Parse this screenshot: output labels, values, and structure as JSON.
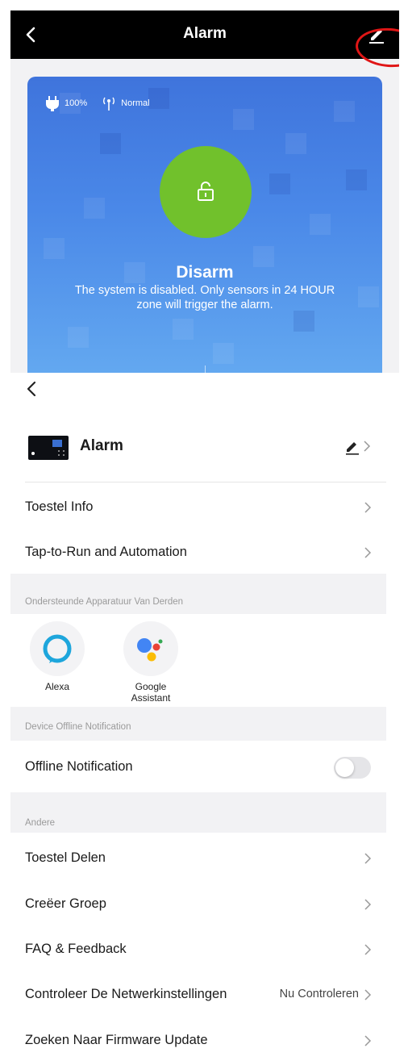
{
  "alarm_screen": {
    "title": "Alarm",
    "battery": "100%",
    "signal": "Normal",
    "mode": "Disarm",
    "mode_description": "The system is disabled. Only sensors in 24 HOUR zone will trigger the alarm.",
    "colors": {
      "header": "#000000",
      "card": "#4a88e8",
      "lock_button": "#71c12c",
      "annotation": "#e01616"
    }
  },
  "settings_screen": {
    "device_name": "Alarm",
    "rows": {
      "device_info": "Toestel Info",
      "tap_to_run": "Tap-to-Run and Automation"
    },
    "third_party_section": "Ondersteunde Apparatuur Van Derden",
    "assistants": [
      {
        "name": "Alexa",
        "icon": "alexa-icon"
      },
      {
        "name": "Google\nAssistant",
        "icon": "google-assistant-icon"
      }
    ],
    "offline_section": "Device Offline Notification",
    "offline_label": "Offline Notification",
    "offline_enabled": false,
    "other_section": "Andere",
    "other_rows": {
      "share": "Toestel Delen",
      "group": "Creëer Groep",
      "faq": "FAQ & Feedback",
      "network": "Controleer De Netwerkinstellingen",
      "network_value": "Nu Controleren",
      "firmware": "Zoeken Naar Firmware Update"
    }
  }
}
